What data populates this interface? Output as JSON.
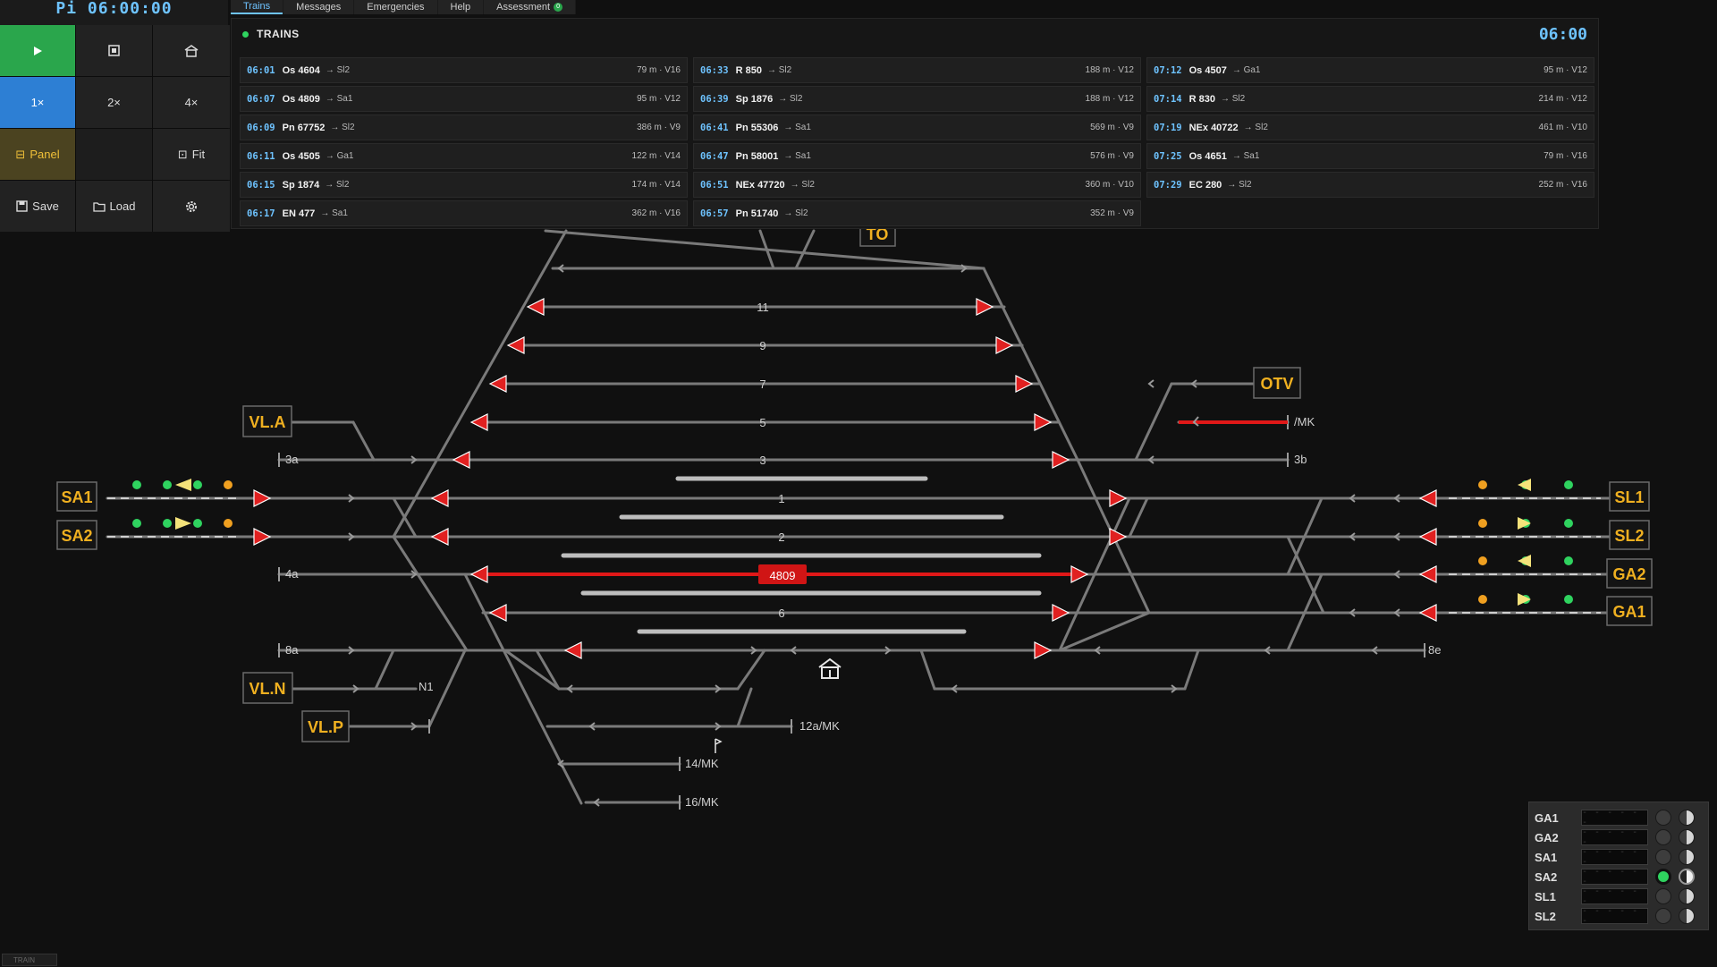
{
  "clock": "Pi 06:00:00",
  "controls": {
    "play_icon": "play-icon",
    "stop_icon": "stop-icon",
    "station_icon": "station-building-icon",
    "speed_1x": "1×",
    "speed_2x": "2×",
    "speed_4x": "4×",
    "panel_label": "Panel",
    "fit_label": "Fit",
    "save_label": "Save",
    "load_label": "Load",
    "settings_icon": "gear-icon"
  },
  "tabs": [
    {
      "label": "Trains"
    },
    {
      "label": "Messages"
    },
    {
      "label": "Emergencies"
    },
    {
      "label": "Help"
    },
    {
      "label": "Assessment",
      "badge": "0"
    }
  ],
  "trains_panel": {
    "title": "TRAINS",
    "clock": "06:00",
    "rows": [
      {
        "time": "06:01",
        "name": "Os 4604",
        "dest": "→ Sl2",
        "info": "79 m · V16"
      },
      {
        "time": "06:33",
        "name": "R 850",
        "dest": "→ Sl2",
        "info": "188 m · V12"
      },
      {
        "time": "07:12",
        "name": "Os 4507",
        "dest": "→ Ga1",
        "info": "95 m · V12"
      },
      {
        "time": "06:07",
        "name": "Os 4809",
        "dest": "→ Sa1",
        "info": "95 m · V12"
      },
      {
        "time": "06:39",
        "name": "Sp 1876",
        "dest": "→ Sl2",
        "info": "188 m · V12"
      },
      {
        "time": "07:14",
        "name": "R 830",
        "dest": "→ Sl2",
        "info": "214 m · V12"
      },
      {
        "time": "06:09",
        "name": "Pn 67752",
        "dest": "→ Sl2",
        "info": "386 m · V9"
      },
      {
        "time": "06:41",
        "name": "Pn 55306",
        "dest": "→ Sa1",
        "info": "569 m · V9"
      },
      {
        "time": "07:19",
        "name": "NEx 40722",
        "dest": "→ Sl2",
        "info": "461 m · V10"
      },
      {
        "time": "06:11",
        "name": "Os 4505",
        "dest": "→ Ga1",
        "info": "122 m · V14"
      },
      {
        "time": "06:47",
        "name": "Pn 58001",
        "dest": "→ Sa1",
        "info": "576 m · V9"
      },
      {
        "time": "07:25",
        "name": "Os 4651",
        "dest": "→ Sa1",
        "info": "79 m · V16"
      },
      {
        "time": "06:15",
        "name": "Sp 1874",
        "dest": "→ Sl2",
        "info": "174 m · V14"
      },
      {
        "time": "06:51",
        "name": "NEx 47720",
        "dest": "→ Sl2",
        "info": "360 m · V10"
      },
      {
        "time": "07:29",
        "name": "EC 280",
        "dest": "→ Sl2",
        "info": "252 m · V16"
      },
      {
        "time": "06:17",
        "name": "EN 477",
        "dest": "→ Sa1",
        "info": "362 m · V16"
      },
      {
        "time": "06:57",
        "name": "Pn 51740",
        "dest": "→ Sl2",
        "info": "352 m · V9"
      }
    ]
  },
  "diagram": {
    "stations": {
      "sa1": "SA1",
      "sa2": "SA2",
      "sl1": "SL1",
      "sl2": "SL2",
      "ga2": "GA2",
      "ga1": "GA1",
      "vla": "VL.A",
      "vln": "VL.N",
      "vlp": "VL.P",
      "otv": "OTV",
      "to": "TO"
    },
    "track_labels": {
      "t11": "11",
      "t9": "9",
      "t7": "7",
      "t5": "5",
      "t3": "3",
      "t1": "1",
      "t2": "2",
      "t6": "6",
      "t3a": "3a",
      "t4a": "4a",
      "t8a": "8a",
      "t3b": "3b",
      "t8e": "8e",
      "mk": "/MK",
      "n1": "N1",
      "t12a": "12a/MK",
      "t14": "14/MK",
      "t16": "16/MK"
    },
    "occupied_train": "4809",
    "colors": {
      "track": "#7a7a7a",
      "occupied": "#e01818",
      "signal": "#e02020",
      "station": "#f0b020",
      "platform": "#bdbdbd"
    }
  },
  "signal_panel": {
    "placeholder": "- - - - - -",
    "rows": [
      {
        "name": "GA1",
        "active": false
      },
      {
        "name": "GA2",
        "active": false
      },
      {
        "name": "SA1",
        "active": false
      },
      {
        "name": "SA2",
        "active": true
      },
      {
        "name": "SL1",
        "active": false
      },
      {
        "name": "SL2",
        "active": false
      }
    ]
  },
  "bottom_tab": "TRAIN"
}
